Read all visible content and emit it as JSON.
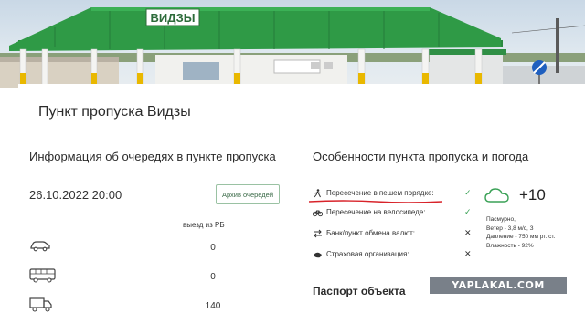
{
  "hero": {
    "sign_text": "ВИДЗЫ"
  },
  "page": {
    "title": "Пункт пропуска Видзы"
  },
  "queues": {
    "section_title": "Информация об очередях в пункте пропуска",
    "date": "26.10.2022 20:00",
    "archive_button": "Архив очередей",
    "direction_label": "выезд из РБ",
    "rows": [
      {
        "icon": "car-icon",
        "count": "0"
      },
      {
        "icon": "bus-icon",
        "count": "0"
      },
      {
        "icon": "truck-icon",
        "count": "140"
      }
    ]
  },
  "features": {
    "section_title": "Особенности пункта пропуска и погода",
    "items": [
      {
        "icon": "pedestrian-icon",
        "label": "Пересечение в пешем порядке:",
        "mark": "✓",
        "available": true
      },
      {
        "icon": "bicycle-icon",
        "label": "Пересечение на велосипеде:",
        "mark": "✓",
        "available": true
      },
      {
        "icon": "exchange-icon",
        "label": "Банк/пункт обмена валют:",
        "mark": "✕",
        "available": false
      },
      {
        "icon": "insurance-icon",
        "label": "Страховая организация:",
        "mark": "✕",
        "available": false
      }
    ]
  },
  "weather": {
    "icon": "cloud-icon",
    "temperature": "+10",
    "condition": "Пасмурно,",
    "wind": "Ветер - 3,8 м/с, З",
    "pressure": "Давление - 750 мм рт. ст.",
    "humidity": "Влажность - 92%"
  },
  "passport": {
    "title": "Паспорт объекта"
  },
  "watermark": {
    "text": "YAPLAKAL.COM"
  },
  "colors": {
    "accent_green": "#3aa156",
    "roof_green": "#2f9a46",
    "annotation_red": "#d8232a"
  }
}
